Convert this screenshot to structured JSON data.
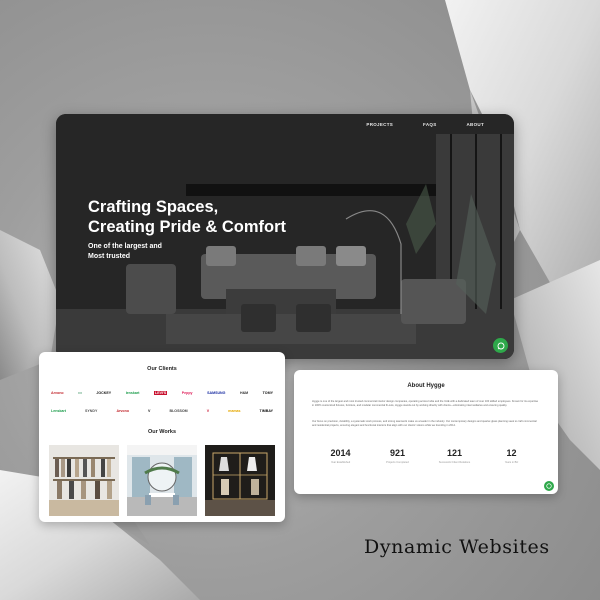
{
  "hero": {
    "nav": [
      "PROJECTS",
      "FAQS",
      "ABOUT"
    ],
    "title": "Crafting Spaces,\nCreating Pride & Comfort",
    "subtitle": "One of the largest and\nMost trusted"
  },
  "clients": {
    "title": "Our Clients",
    "logos_row1": [
      "Arvono",
      "•••",
      "JOCKEY",
      "lenskart",
      "LEVI'S",
      "Peppy",
      "SAMSUNG",
      "H&M",
      "TOMY"
    ],
    "logos_row2": [
      "Lenskart",
      "SYNDY",
      "Arvono",
      "V",
      "BLOSSOM",
      "V",
      "mamas",
      "TIMBAY"
    ],
    "works_title": "Our Works"
  },
  "about": {
    "title": "About Hygge",
    "paragraph1": "Hygge is one of the largest and most trusted commercial interior design companies, operating across India and the UAE with a dedicated team of over 100 skilled employees. Known for its expertise in 100% customized fixtures, furniture, and modular commercial fit-outs, Hygge stands out by working directly with clients—eliminating intermediaries and ensuring quality.",
    "paragraph2": "Our focus on precision, durability, a systematic work process, and strong teamwork make us a leader in the industry. Our contemporary designs and quarter-glass planning seek to craft commercial and residential projects, ensuring elegant and functional interiors that align with our clients' visions while we founding in 2014.",
    "stats": [
      {
        "value": "2014",
        "label": "Year Established"
      },
      {
        "value": "921",
        "label": "Projects Completed"
      },
      {
        "value": "121",
        "label": "Successful Client Relations"
      },
      {
        "value": "12",
        "label": "Years in Biz"
      }
    ]
  },
  "caption": "Dynamic Websites",
  "colors": {
    "accent": "#2ea84a"
  }
}
